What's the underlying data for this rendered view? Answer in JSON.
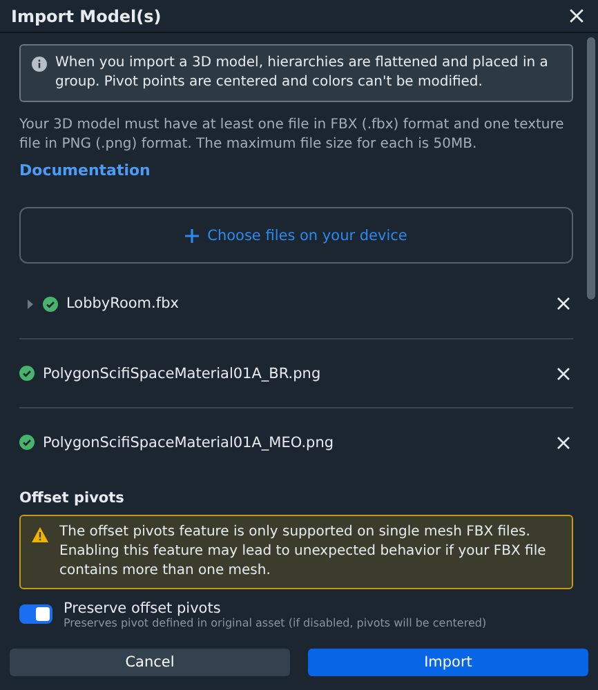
{
  "window": {
    "title": "Import Model(s)"
  },
  "info": "When you import a 3D model, hierarchies are flattened and placed in a group. Pivot points are centered and colors can't be modified.",
  "requirements": "Your 3D model must have at least one file in FBX (.fbx) format and one texture file in PNG (.png) format. The maximum file size for each is 50MB.",
  "documentation_link": "Documentation",
  "upload": {
    "label": "Choose files on your device"
  },
  "files": [
    {
      "name": "LobbyRoom.fbx",
      "uploaded": true,
      "expanded": false
    },
    {
      "name": "PolygonScifiSpaceMaterial01A_BR.png",
      "uploaded": true
    },
    {
      "name": "PolygonScifiSpaceMaterial01A_MEO.png",
      "uploaded": true
    }
  ],
  "offset_pivots": {
    "heading": "Offset pivots",
    "warning": "The offset pivots feature is only supported on single mesh FBX files. Enabling this feature may lead to unexpected behavior if your FBX file contains more than one mesh.",
    "toggle": {
      "label": "Preserve offset pivots",
      "description": "Preserves pivot defined in original asset (if disabled, pivots will be centered)",
      "on": true
    }
  },
  "buttons": [
    {
      "label": "Cancel",
      "kind": "secondary"
    },
    {
      "label": "Import",
      "kind": "primary"
    }
  ]
}
